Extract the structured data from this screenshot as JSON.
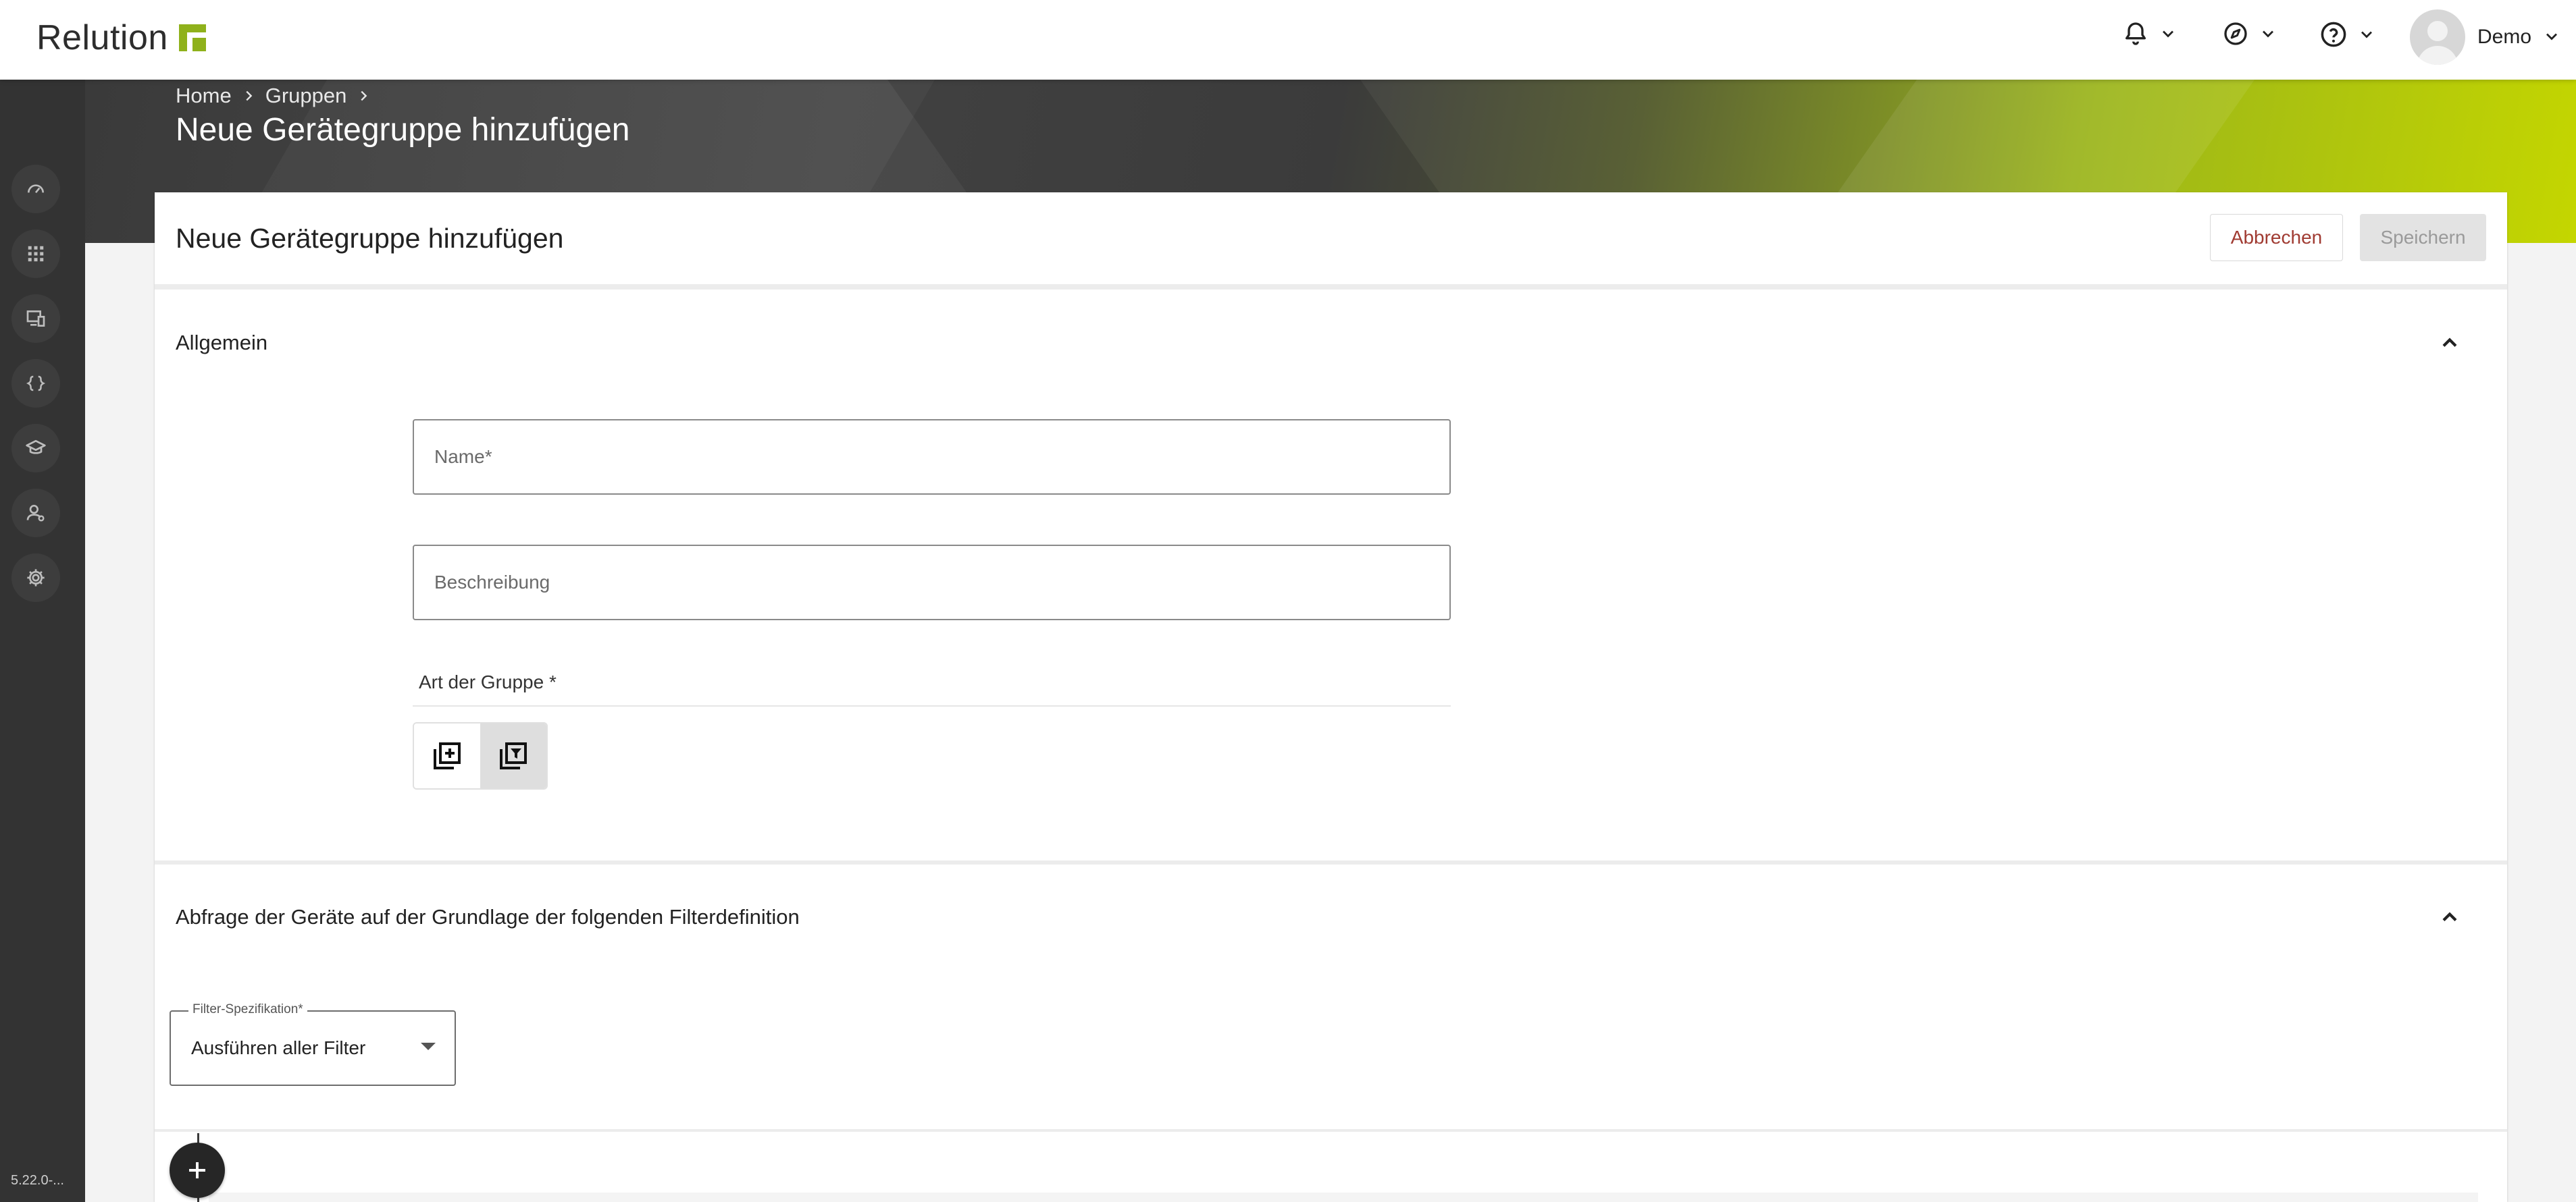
{
  "app": {
    "logo_text": "Relution",
    "brand_color": "#8fb11b"
  },
  "header": {
    "icons": [
      "bell-icon",
      "compass-icon",
      "help-icon"
    ],
    "user": {
      "name": "Demo"
    }
  },
  "sidebar": {
    "items": [
      "dashboard-icon",
      "apps-grid-icon",
      "devices-icon",
      "code-braces-icon",
      "education-icon",
      "users-icon",
      "settings-icon"
    ],
    "version": "5.22.0-..."
  },
  "breadcrumb": {
    "items": [
      "Home",
      "Gruppen"
    ]
  },
  "page": {
    "title": "Neue Gerätegruppe hinzufügen"
  },
  "card": {
    "title": "Neue Gerätegruppe hinzufügen",
    "cancel_label": "Abbrechen",
    "save_label": "Speichern"
  },
  "general": {
    "title": "Allgemein",
    "name_placeholder": "Name*",
    "description_placeholder": "Beschreibung",
    "group_type_label": "Art der Gruppe *",
    "group_type_selected": "filter"
  },
  "filter": {
    "title": "Abfrage der Geräte auf der Grundlage der folgenden Filterdefinition",
    "spec_label": "Filter-Spezifikation*",
    "spec_value": "Ausführen aller Filter"
  }
}
